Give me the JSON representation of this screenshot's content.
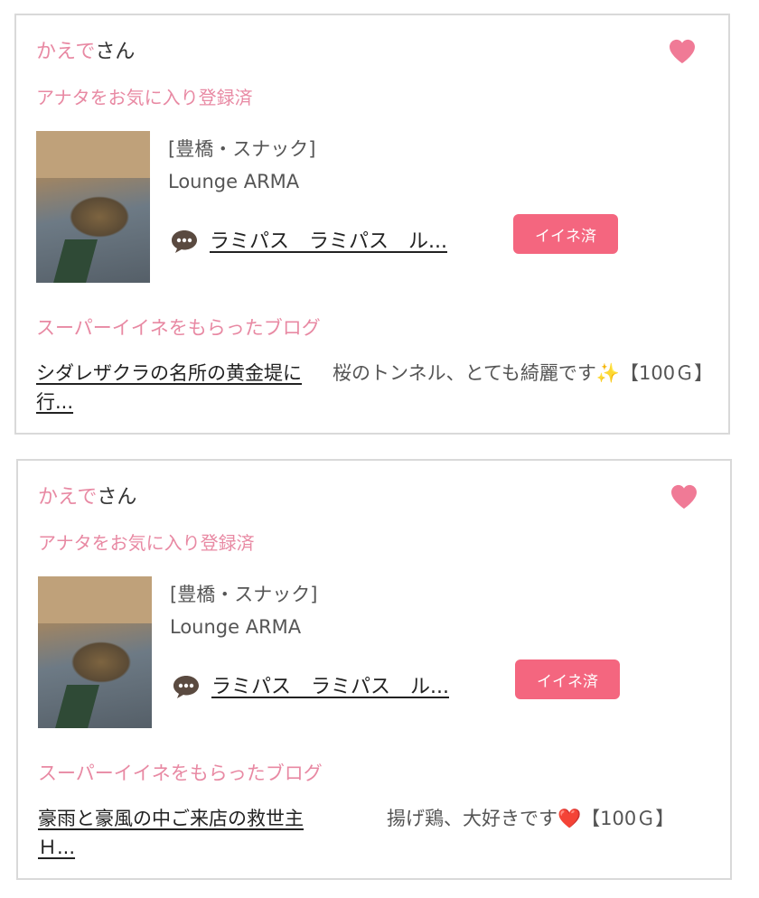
{
  "cards": [
    {
      "user_name": "かえで",
      "user_suffix": "さん",
      "favorite_status": "アナタをお気に入り登録済",
      "shop_category": "[豊橋・スナック]",
      "shop_name": "Lounge ARMA",
      "blog_title": "ラミパス　ラミパス　ル...",
      "like_button": "イイネ済",
      "super_like_heading": "スーパーイイネをもらったブログ",
      "post_title": "シダレザクラの名所の黄金堤に行...",
      "post_description": "桜のトンネル、とても綺麗です✨【100Ｇ】"
    },
    {
      "user_name": "かえで",
      "user_suffix": "さん",
      "favorite_status": "アナタをお気に入り登録済",
      "shop_category": "[豊橋・スナック]",
      "shop_name": "Lounge ARMA",
      "blog_title": "ラミパス　ラミパス　ル...",
      "like_button": "イイネ済",
      "super_like_heading": "スーパーイイネをもらったブログ",
      "post_title": "豪雨と豪風の中ご来店の救世主Ｈ...",
      "post_description": "揚げ鶏、大好きです❤️【100Ｇ】"
    }
  ],
  "colors": {
    "accent_pink": "#e889a3",
    "button_pink": "#f4667f",
    "heart_pink": "#f07a96"
  },
  "icons": {
    "favorite": "heart-icon",
    "comment": "speech-bubble-icon"
  }
}
